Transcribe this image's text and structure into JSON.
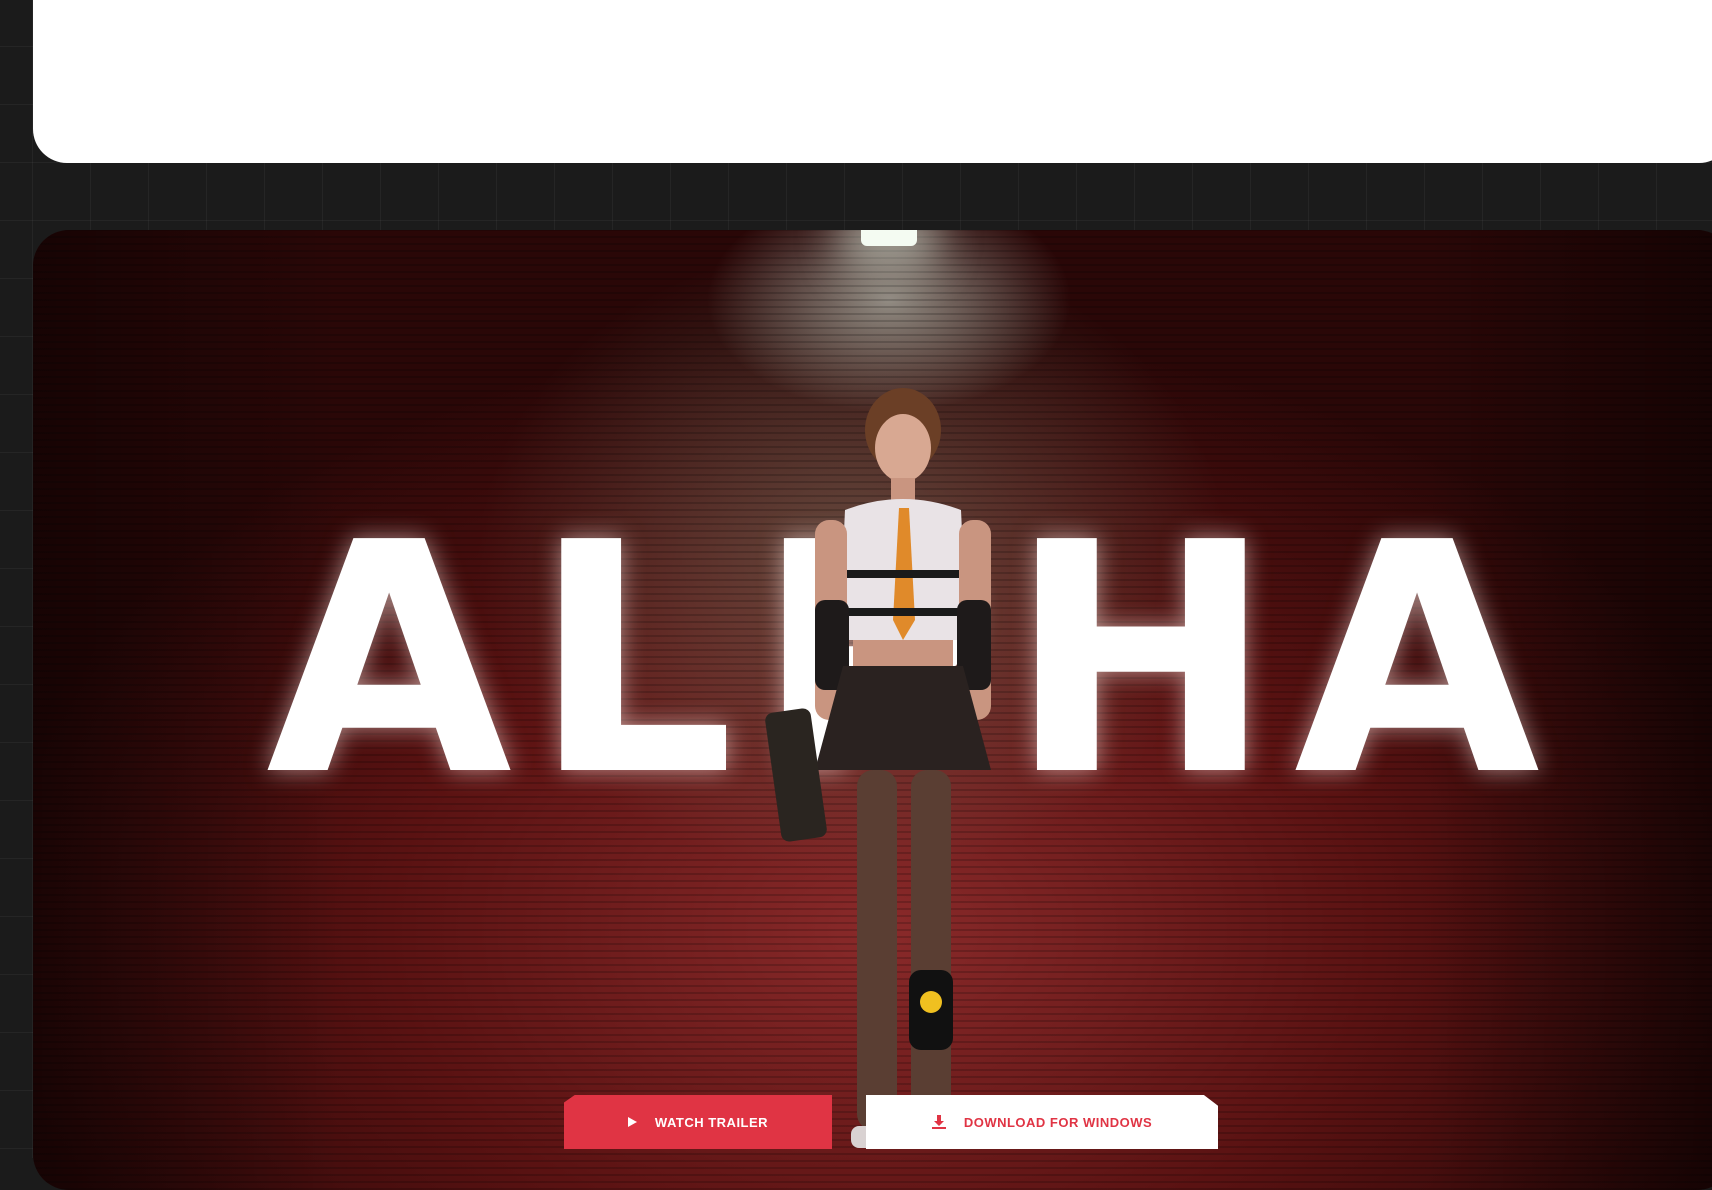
{
  "hero": {
    "title": "ALPHA",
    "actions": {
      "watch_trailer_label": "WATCH TRAILER",
      "download_label": "DOWNLOAD FOR WINDOWS"
    },
    "icons": {
      "trailer": "play-icon",
      "download": "download-icon"
    }
  },
  "colors": {
    "accent": "#e03444",
    "page_background": "#1b1b1b",
    "card_background": "#ffffff"
  }
}
